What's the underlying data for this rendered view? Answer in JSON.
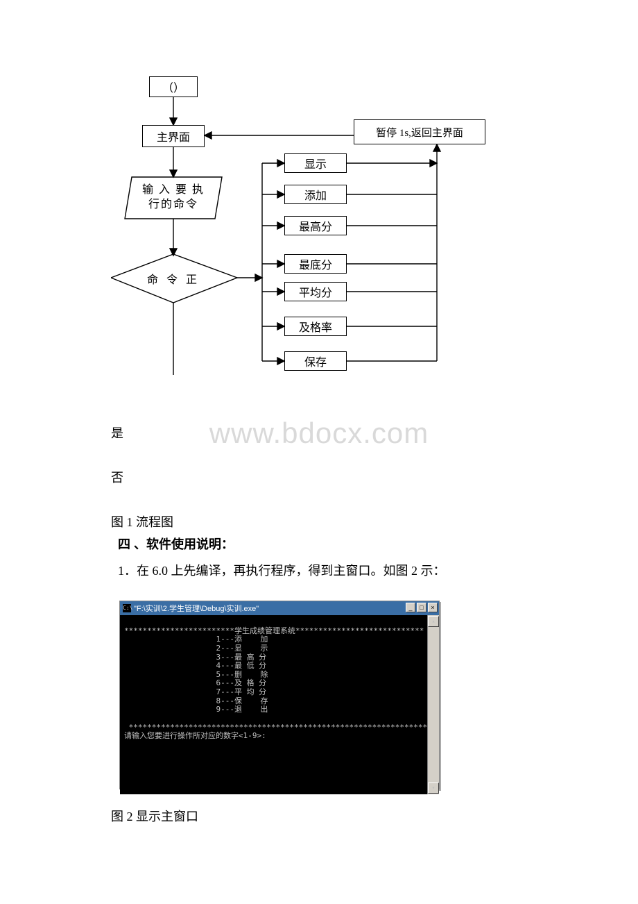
{
  "flowchart": {
    "start": "（）",
    "main_ui": "主界面",
    "pause_return": "暂停 1s,返回主界面",
    "input_command": "输 入 要 执\n行的命令",
    "decision": "命 令 正",
    "actions": {
      "show": "显示",
      "add": "添加",
      "highest": "最高分",
      "lowest": "最底分",
      "average": "平均分",
      "pass_rate": "及格率",
      "save": "保存"
    }
  },
  "labels": {
    "yes": "是",
    "no": "否"
  },
  "captions": {
    "fig1": "图 1 流程图",
    "section4": "四 、软件使用说明：",
    "step1": "1．在 6.0 上先编译，再执行程序，得到主窗口。如图 2 示：",
    "fig2": "图 2 显示主窗口"
  },
  "watermark": "www.bdocx.com",
  "console": {
    "title": "\"F:\\实训\\2.学生管理\\Debug\\实训.exe\"",
    "header_line": "************************学生成绩管理系统****************************",
    "menu": [
      "1---添    加",
      "2---显    示",
      "3---最 高 分",
      "4---最 低 分",
      "5---删    除",
      "6---及 格 分",
      "7---平 均 分",
      "8---保    存",
      "9---退    出"
    ],
    "footer_line": " ********************************************************************",
    "prompt": "请输入您要进行操作所对应的数字<1-9>:"
  }
}
